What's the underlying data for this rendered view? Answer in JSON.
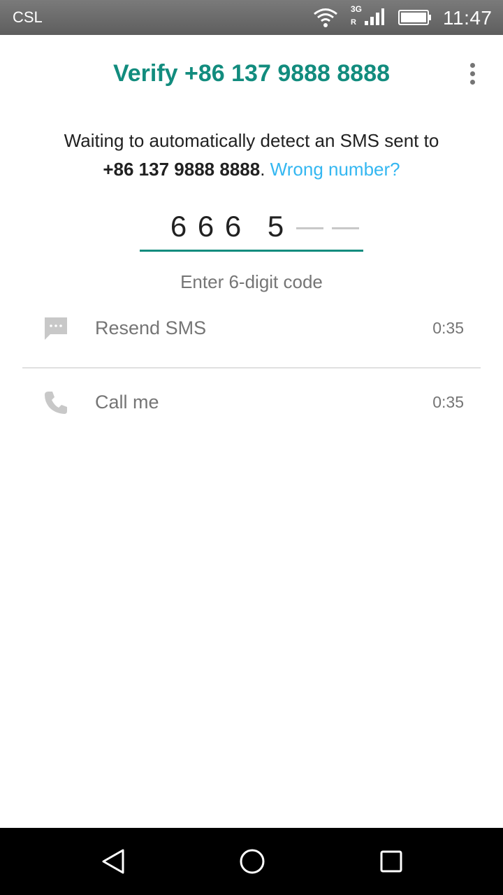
{
  "status_bar": {
    "carrier": "CSL",
    "network_type": "3G",
    "roaming": "R",
    "time": "11:47",
    "icons": [
      "wifi-icon",
      "signal-icon",
      "battery-icon"
    ]
  },
  "header": {
    "title": "Verify +86 137 9888 8888",
    "menu_icon": "more-vert-icon"
  },
  "description": {
    "text": "Waiting to automatically detect an SMS sent to",
    "phone": "+86 137 9888 8888",
    "period": ".",
    "wrong_number_link": "Wrong number?"
  },
  "code_input": {
    "digits": [
      "6",
      "6",
      "6",
      "5"
    ],
    "total_digits": 6,
    "hint": "Enter 6-digit code"
  },
  "actions": [
    {
      "label": "Resend SMS",
      "timer": "0:35",
      "icon": "sms-icon"
    },
    {
      "label": "Call me",
      "timer": "0:35",
      "icon": "phone-icon"
    }
  ],
  "colors": {
    "accent": "#128c7e",
    "link": "#34b7f1",
    "secondary_text": "#757575"
  },
  "nav_bar": {
    "icons": [
      "back-icon",
      "home-icon",
      "recents-icon"
    ]
  }
}
